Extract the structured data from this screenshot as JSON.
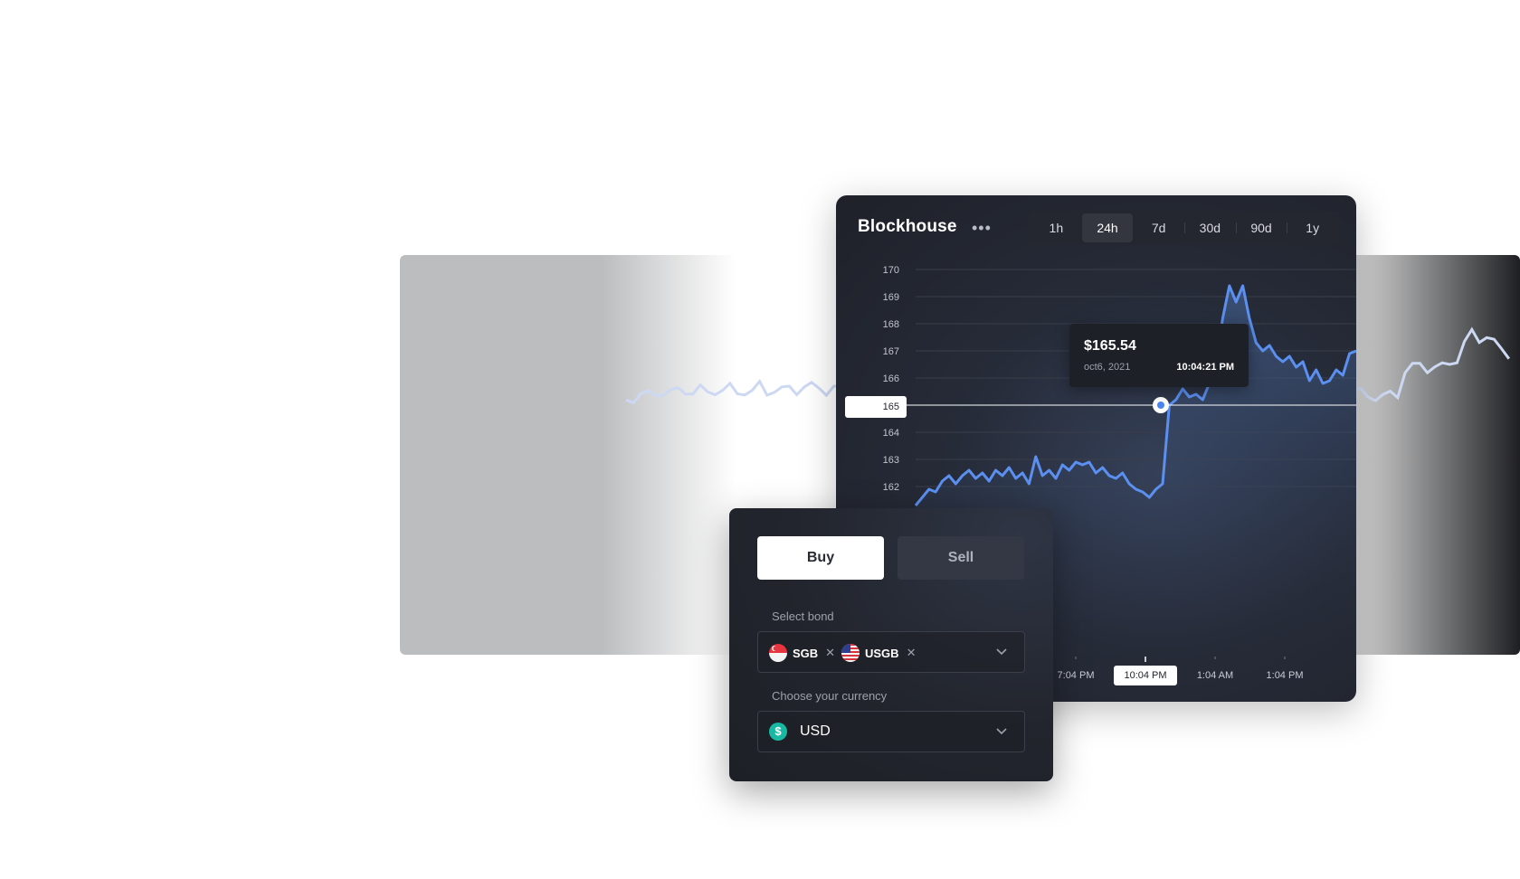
{
  "chart_card": {
    "title": "Blockhouse",
    "more_icon": "ellipsis-icon",
    "range_tabs": [
      "1h",
      "24h",
      "7d",
      "30d",
      "90d",
      "1y"
    ],
    "active_range": "24h"
  },
  "tooltip": {
    "price": "$165.54",
    "date": "oct6, 2021",
    "time": "10:04:21 PM"
  },
  "y_marker": "165",
  "x_axis_labels": [
    "7:04 PM",
    "10:04 PM",
    "1:04 AM",
    "1:04 PM"
  ],
  "active_x_label": "10:04 PM",
  "chart_data": {
    "type": "line",
    "ylim": [
      161,
      170
    ],
    "y_ticks": [
      "170",
      "169",
      "168",
      "167",
      "166",
      "165",
      "164",
      "163",
      "162"
    ],
    "cursor_value": 165,
    "series": [
      {
        "values": [
          161.3,
          161.6,
          161.9,
          161.8,
          162.2,
          162.4,
          162.1,
          162.4,
          162.6,
          162.3,
          162.5,
          162.2,
          162.6,
          162.4,
          162.7,
          162.3,
          162.5,
          162.1,
          163.1,
          162.4,
          162.6,
          162.3,
          162.8,
          162.6,
          162.9,
          162.8,
          162.9,
          162.5,
          162.7,
          162.4,
          162.3,
          162.5,
          162.1,
          161.9,
          161.8,
          161.6,
          161.9,
          162.1,
          165.0,
          165.2,
          165.6,
          165.3,
          165.4,
          165.2,
          165.8,
          166.5,
          168.2,
          169.4,
          168.8,
          169.4,
          168.2,
          167.3,
          167.0,
          167.2,
          166.8,
          166.6,
          166.8,
          166.4,
          166.6,
          165.9,
          166.3,
          165.8,
          165.9,
          166.3,
          166.1,
          166.9,
          167.0
        ],
        "x_start": "7:04 PM",
        "x_end": "1:04 PM"
      }
    ]
  },
  "trade_panel": {
    "buy_label": "Buy",
    "sell_label": "Sell",
    "bond_label": "Select bond",
    "bond_chips": [
      {
        "label": "SGB",
        "flag": "singapore-flag-icon"
      },
      {
        "label": "USGB",
        "flag": "us-flag-icon"
      }
    ],
    "currency_label": "Choose your currency",
    "currency_value": "USD",
    "currency_icon": "dollar-coin-icon"
  },
  "colors": {
    "line": "#5b8ff0",
    "card_bg": "#22252d",
    "accent_teal": "#18b9a2"
  }
}
